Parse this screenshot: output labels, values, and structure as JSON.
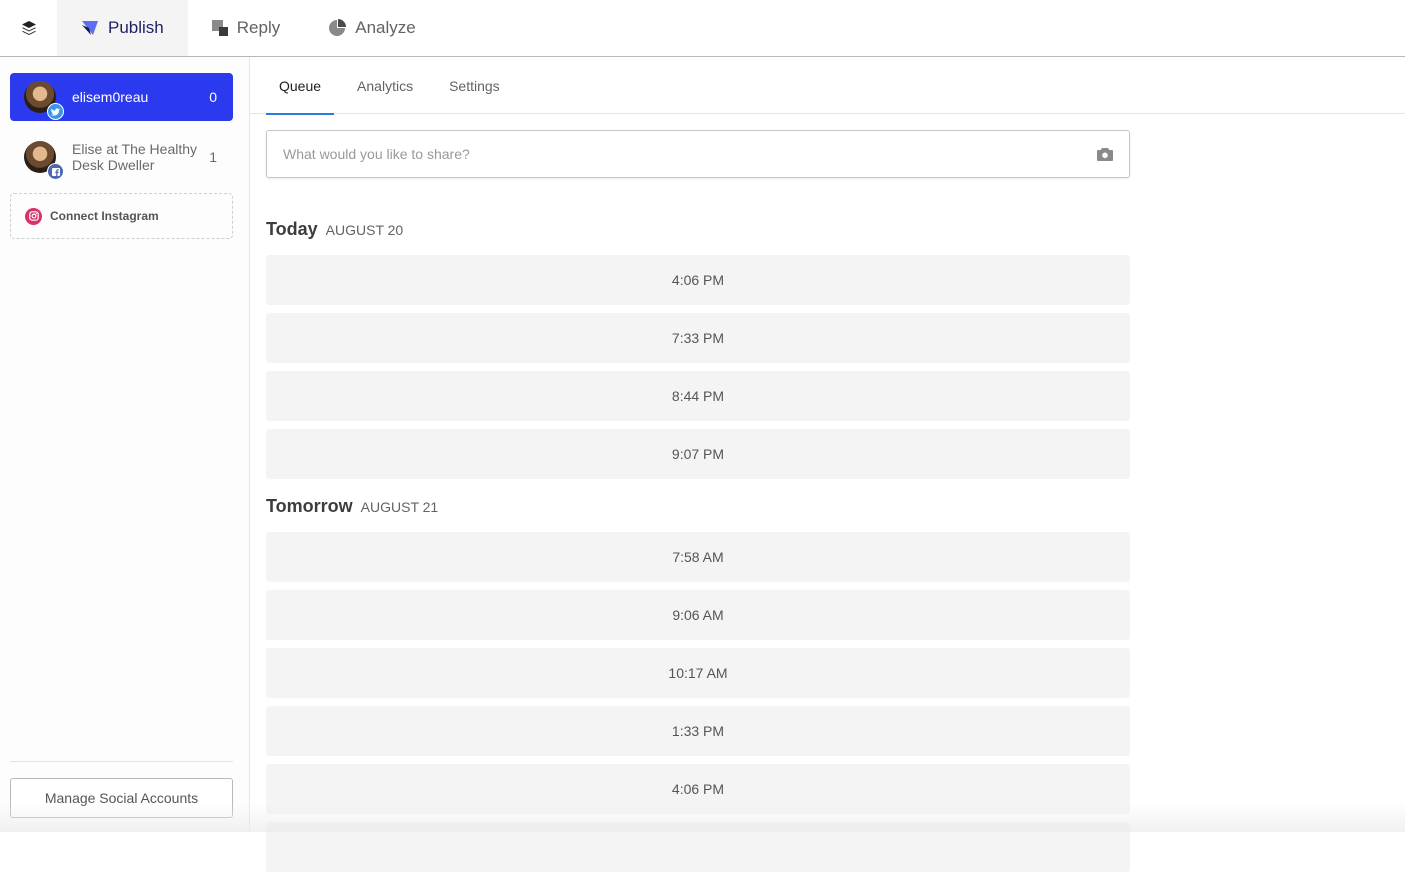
{
  "topnav": {
    "logo_icon": "layers-icon",
    "tabs": [
      {
        "label": "Publish",
        "icon": "publish-icon",
        "active": true
      },
      {
        "label": "Reply",
        "icon": "reply-icon",
        "active": false
      },
      {
        "label": "Analyze",
        "icon": "pie-chart-icon",
        "active": false
      }
    ]
  },
  "sidebar": {
    "accounts": [
      {
        "name": "elisem0reau",
        "network": "twitter",
        "count": "0",
        "active": true
      },
      {
        "name": "Elise at The Healthy Desk Dweller",
        "network": "facebook",
        "count": "1",
        "active": false
      }
    ],
    "connect_instagram": "Connect Instagram",
    "manage_button": "Manage Social Accounts"
  },
  "main": {
    "subtabs": [
      {
        "label": "Queue",
        "active": true
      },
      {
        "label": "Analytics",
        "active": false
      },
      {
        "label": "Settings",
        "active": false
      }
    ],
    "composer": {
      "placeholder": "What would you like to share?",
      "value": ""
    },
    "days": [
      {
        "day": "Today",
        "date": "AUGUST 20",
        "slots": [
          "4:06 PM",
          "7:33 PM",
          "8:44 PM",
          "9:07 PM"
        ]
      },
      {
        "day": "Tomorrow",
        "date": "AUGUST 21",
        "slots": [
          "7:58 AM",
          "9:06 AM",
          "10:17 AM",
          "1:33 PM",
          "4:06 PM",
          ""
        ]
      }
    ]
  },
  "colors": {
    "accent": "#2c3aef",
    "tab_underline": "#2c7be5",
    "twitter": "#3d95e8",
    "facebook": "#4d67b0",
    "instagram": "#d6336c"
  }
}
